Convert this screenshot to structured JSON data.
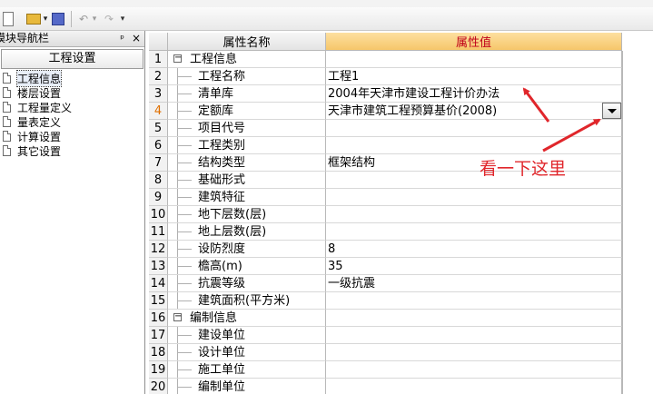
{
  "toolbar": {
    "open_dropdown": "▾",
    "undo": "↶",
    "undo_dropdown": "▾",
    "redo": "↷",
    "redo_dropdown": "▾"
  },
  "nav": {
    "title": "模块导航栏",
    "pin": "ᵖ",
    "close": "×",
    "header": "工程设置",
    "items": [
      {
        "label": "工程信息",
        "selected": true
      },
      {
        "label": "楼层设置"
      },
      {
        "label": "工程量定义"
      },
      {
        "label": "量表定义"
      },
      {
        "label": "计算设置"
      },
      {
        "label": "其它设置"
      }
    ]
  },
  "grid": {
    "col_name": "属性名称",
    "col_value": "属性值",
    "rows": [
      {
        "no": "1",
        "name": "工程信息",
        "value": "",
        "group": true,
        "expander": "−"
      },
      {
        "no": "2",
        "name": "工程名称",
        "value": "工程1"
      },
      {
        "no": "3",
        "name": "清单库",
        "value": "2004年天津市建设工程计价办法"
      },
      {
        "no": "4",
        "name": "定额库",
        "value": "天津市建筑工程预算基价(2008)",
        "active": true
      },
      {
        "no": "5",
        "name": "项目代号",
        "value": ""
      },
      {
        "no": "6",
        "name": "工程类别",
        "value": ""
      },
      {
        "no": "7",
        "name": "结构类型",
        "value": "框架结构"
      },
      {
        "no": "8",
        "name": "基础形式",
        "value": ""
      },
      {
        "no": "9",
        "name": "建筑特征",
        "value": ""
      },
      {
        "no": "10",
        "name": "地下层数(层)",
        "value": ""
      },
      {
        "no": "11",
        "name": "地上层数(层)",
        "value": ""
      },
      {
        "no": "12",
        "name": "设防烈度",
        "value": "8"
      },
      {
        "no": "13",
        "name": "檐高(m)",
        "value": "35"
      },
      {
        "no": "14",
        "name": "抗震等级",
        "value": "一级抗震"
      },
      {
        "no": "15",
        "name": "建筑面积(平方米)",
        "value": ""
      },
      {
        "no": "16",
        "name": "编制信息",
        "value": "",
        "group": true,
        "expander": "−"
      },
      {
        "no": "17",
        "name": "建设单位",
        "value": ""
      },
      {
        "no": "18",
        "name": "设计单位",
        "value": ""
      },
      {
        "no": "19",
        "name": "施工单位",
        "value": ""
      },
      {
        "no": "20",
        "name": "编制单位",
        "value": ""
      }
    ]
  },
  "annotation": {
    "text": "看一下这里",
    "color": "#e0262b"
  },
  "colors": {
    "header_value_bg": "#f6c66a",
    "header_value_text": "#c0001a",
    "active_row_no": "#e07000"
  }
}
